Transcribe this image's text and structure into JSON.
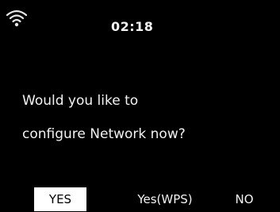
{
  "status_bar": {
    "wifi_icon": "wifi-icon",
    "time": "02:18"
  },
  "dialog": {
    "prompt_line_1": "Would you like to",
    "prompt_line_2": "configure Network now?"
  },
  "options": {
    "yes_label": "YES",
    "wps_label": "Yes(WPS)",
    "no_label": "NO",
    "selected": "YES"
  },
  "colors": {
    "background": "#000000",
    "text": "#f2f2f2",
    "highlight_bg": "#ffffff",
    "highlight_text": "#000000"
  }
}
